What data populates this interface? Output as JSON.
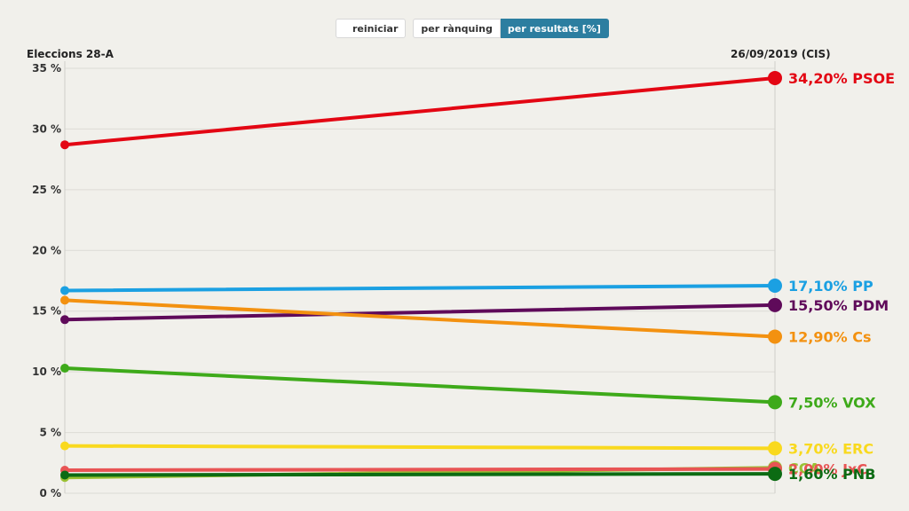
{
  "controls": {
    "reset_label": "reiniciar",
    "by_rank_label": "per rànquing",
    "by_results_label": "per resultats [%]"
  },
  "chart_data": {
    "type": "line",
    "x": [
      "Eleccions 28-A",
      "26/09/2019 (CIS)"
    ],
    "ylim": [
      0,
      35
    ],
    "y_ticks": [
      "0 %",
      "5 %",
      "10 %",
      "15 %",
      "20 %",
      "25 %",
      "30 %",
      "35 %"
    ],
    "grid": true,
    "series": [
      {
        "name": "PSOE",
        "values": [
          28.7,
          34.2
        ],
        "label": "34,20% PSOE",
        "color": "#e30613"
      },
      {
        "name": "PP",
        "values": [
          16.7,
          17.1
        ],
        "label": "17,10% PP",
        "color": "#1ba0e2"
      },
      {
        "name": "PDM",
        "values": [
          14.3,
          15.5
        ],
        "label": "15,50% PDM",
        "color": "#5f0a5a"
      },
      {
        "name": "Cs",
        "values": [
          15.9,
          12.9
        ],
        "label": "12,90% Cs",
        "color": "#f39110"
      },
      {
        "name": "VOX",
        "values": [
          10.3,
          7.5
        ],
        "label": "7,50% VOX",
        "color": "#3eaa1a"
      },
      {
        "name": "ERC",
        "values": [
          3.9,
          3.7
        ],
        "label": "3,70% ERC",
        "color": "#f9d91e"
      },
      {
        "name": "CCA",
        "values": [
          1.3,
          2.1
        ],
        "label": "CCA",
        "color": "#9ac133"
      },
      {
        "name": "JxC",
        "values": [
          1.9,
          2.0
        ],
        "label": "2,00% JxC",
        "color": "#e85454"
      },
      {
        "name": "PNB",
        "values": [
          1.5,
          1.6
        ],
        "label": "1,60% PNB",
        "color": "#0c6b13"
      }
    ]
  }
}
